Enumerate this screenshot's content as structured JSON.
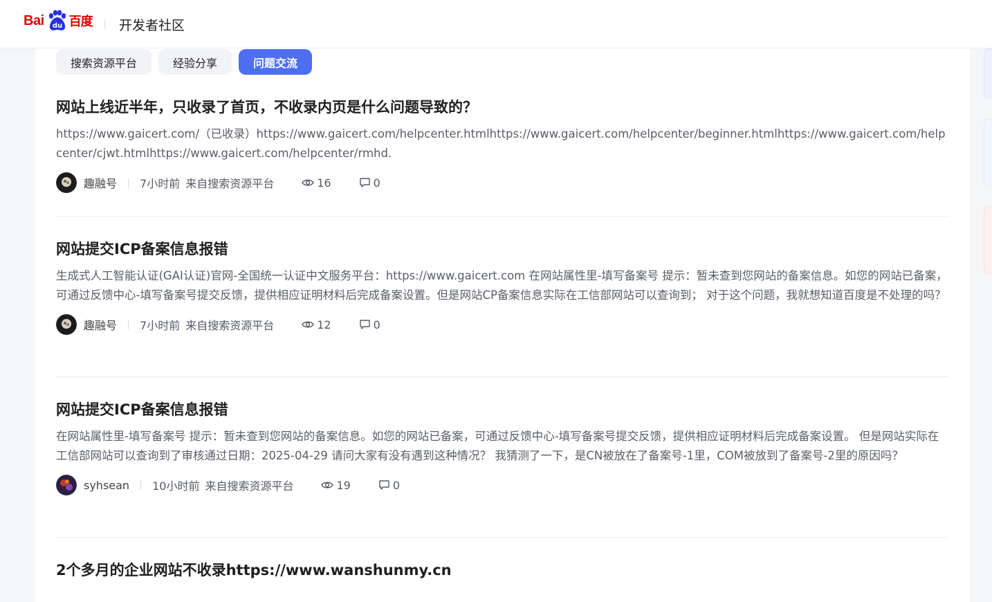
{
  "header": {
    "logo_text_left": "Bai",
    "logo_text_right": "百度",
    "site_title": "开发者社区"
  },
  "tabs": [
    {
      "label": "搜索资源平台",
      "active": false
    },
    {
      "label": "经验分享",
      "active": false
    },
    {
      "label": "问题交流",
      "active": true
    }
  ],
  "posts": [
    {
      "title": "网站上线近半年，只收录了首页，不收录内页是什么问题导致的？",
      "desc": "https://www.gaicert.com/（已收录）https://www.gaicert.com/helpcenter.htmlhttps://www.gaicert.com/helpcenter/beginner.htmlhttps://www.gaicert.com/helpcenter/cjwt.htmlhttps://www.gaicert.com/helpcenter/rmhd.",
      "author": "趣融号",
      "time": "7小时前",
      "source": "来自搜索资源平台",
      "views": "16",
      "comments": "0"
    },
    {
      "title": "网站提交ICP备案信息报错",
      "desc": "生成式人工智能认证(GAI认证)官网-全国统一认证中文服务平台：https://www.gaicert.com 在网站属性里-填写备案号 提示：暂未查到您网站的备案信息。如您的网站已备案，可通过反馈中心-填写备案号提交反馈，提供相应证明材料后完成备案设置。但是网站CP备案信息实际在工信部网站可以查询到； 对于这个问题，我就想知道百度是不处理的吗？",
      "author": "趣融号",
      "time": "7小时前",
      "source": "来自搜索资源平台",
      "views": "12",
      "comments": "0"
    },
    {
      "title": "网站提交ICP备案信息报错",
      "desc": "在网站属性里-填写备案号 提示：暂未查到您网站的备案信息。如您的网站已备案，可通过反馈中心-填写备案号提交反馈，提供相应证明材料后完成备案设置。 但是网站实际在工信部网站可以查询到了审核通过日期：2025-04-29 请问大家有没有遇到这种情况？ 我猜测了一下，是CN被放在了备案号-1里，COM被放到了备案号-2里的原因吗？",
      "author": "syhsean",
      "time": "10小时前",
      "source": "来自搜索资源平台",
      "views": "19",
      "comments": "0"
    },
    {
      "title": "2个多月的企业网站不收录https://www.wanshunmy.cn",
      "desc": "",
      "author": "",
      "time": "",
      "source": "",
      "views": "",
      "comments": ""
    }
  ],
  "colors": {
    "accent": "#4e6ef2",
    "brand_red": "#e10601"
  }
}
